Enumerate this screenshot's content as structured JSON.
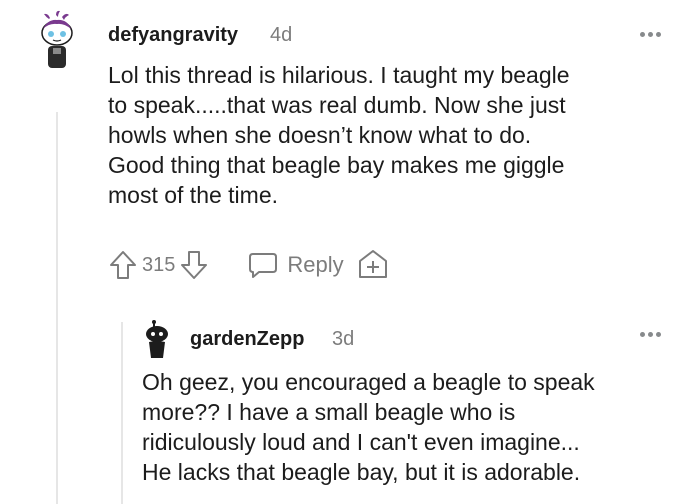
{
  "comment": {
    "username": "defyangravity",
    "age": "4d",
    "body_lines": [
      "Lol this thread is hilarious. I taught my beagle",
      "to speak.....that was real dumb. Now she just",
      "howls when she doesn’t know what to do.",
      "Good thing that beagle bay makes me giggle",
      "most of the time."
    ],
    "score": "315",
    "reply_label": "Reply"
  },
  "reply": {
    "username": "gardenZepp",
    "age": "3d",
    "body_lines": [
      "Oh geez, you encouraged a beagle to speak",
      "more?? I have a small beagle who is",
      "ridiculously loud and I can't even imagine...",
      "He lacks that beagle bay, but it is adorable."
    ]
  },
  "colors": {
    "text": "#1c1c1c",
    "meta": "#7c7c7c",
    "thread_line": "#e6e6e6",
    "avatar_purple": "#7a3a8f"
  },
  "icons": [
    "avatar-icon",
    "more-options-icon",
    "upvote-icon",
    "downvote-icon",
    "reply-bubble-icon",
    "award-plus-icon"
  ]
}
